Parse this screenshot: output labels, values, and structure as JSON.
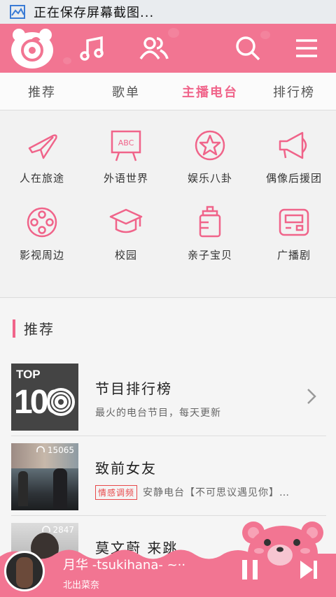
{
  "status_bar": {
    "text": "正在保存屏幕截图..."
  },
  "header": {
    "icons": [
      "netease-cloud-logo-icon",
      "music-note-icon",
      "friends-icon",
      "search-icon",
      "menu-icon"
    ]
  },
  "tabs": [
    {
      "label": "推荐",
      "active": false
    },
    {
      "label": "歌单",
      "active": false
    },
    {
      "label": "主播电台",
      "active": true
    },
    {
      "label": "排行榜",
      "active": false
    }
  ],
  "categories": [
    {
      "label": "人在旅途",
      "icon": "airplane-icon"
    },
    {
      "label": "外语世界",
      "icon": "abc-board-icon"
    },
    {
      "label": "娱乐八卦",
      "icon": "star-icon"
    },
    {
      "label": "偶像后援团",
      "icon": "megaphone-icon"
    },
    {
      "label": "影视周边",
      "icon": "film-reel-icon"
    },
    {
      "label": "校园",
      "icon": "graduation-cap-icon"
    },
    {
      "label": "亲子宝贝",
      "icon": "baby-bottle-icon"
    },
    {
      "label": "广播剧",
      "icon": "radio-icon"
    }
  ],
  "pager": {
    "count": 3,
    "active": 1
  },
  "recommend": {
    "title": "推荐",
    "items": [
      {
        "title": "节目排行榜",
        "subtitle": "最火的电台节目，每天更新",
        "thumb_text_top": "TOP",
        "thumb_text_num": "100"
      },
      {
        "title": "致前女友",
        "tag": "情感调频",
        "subtitle": "安静电台【不可思议遇见你】…",
        "play_count": "15065"
      },
      {
        "title": "莫文蔚 来跳",
        "play_count": "2847"
      }
    ]
  },
  "player": {
    "song": "月华 -tsukihana- ~··",
    "artist": "北出菜奈"
  },
  "colors": {
    "accent": "#f27592",
    "active_text": "#f0648a",
    "tag_red": "#e8484a"
  }
}
